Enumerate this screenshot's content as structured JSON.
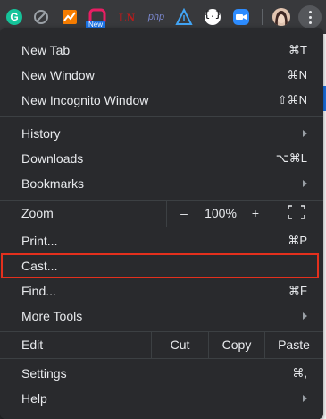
{
  "toolbar": {
    "extensions": [
      {
        "icon": "grammarly-icon"
      },
      {
        "icon": "no-entry-icon"
      },
      {
        "icon": "chart-trend-icon"
      },
      {
        "icon": "new-extension-icon",
        "badge": "New"
      },
      {
        "icon": "ln-icon"
      },
      {
        "icon": "php-icon",
        "text": "php"
      },
      {
        "icon": "triangle-icon"
      },
      {
        "icon": "braces-icon",
        "text": "{.}"
      },
      {
        "icon": "zoom-camera-icon"
      }
    ],
    "profile": {
      "icon": "avatar"
    },
    "menu_button": {
      "icon": "kebab-icon"
    }
  },
  "menu": {
    "new_tab": {
      "label": "New Tab",
      "shortcut": "⌘T"
    },
    "new_window": {
      "label": "New Window",
      "shortcut": "⌘N"
    },
    "new_incognito": {
      "label": "New Incognito Window",
      "shortcut": "⇧⌘N"
    },
    "history": {
      "label": "History"
    },
    "downloads": {
      "label": "Downloads",
      "shortcut": "⌥⌘L"
    },
    "bookmarks": {
      "label": "Bookmarks"
    },
    "zoom": {
      "label": "Zoom",
      "minus": "–",
      "level": "100%",
      "plus": "+"
    },
    "print": {
      "label": "Print...",
      "shortcut": "⌘P"
    },
    "cast": {
      "label": "Cast..."
    },
    "find": {
      "label": "Find...",
      "shortcut": "⌘F"
    },
    "more_tools": {
      "label": "More Tools"
    },
    "edit": {
      "label": "Edit",
      "cut": "Cut",
      "copy": "Copy",
      "paste": "Paste"
    },
    "settings": {
      "label": "Settings",
      "shortcut": "⌘,"
    },
    "help": {
      "label": "Help"
    }
  },
  "colors": {
    "menu_bg": "#292a2d",
    "text": "#e8eaed",
    "highlight_border": "#e3301d",
    "separator": "#3c4043"
  }
}
